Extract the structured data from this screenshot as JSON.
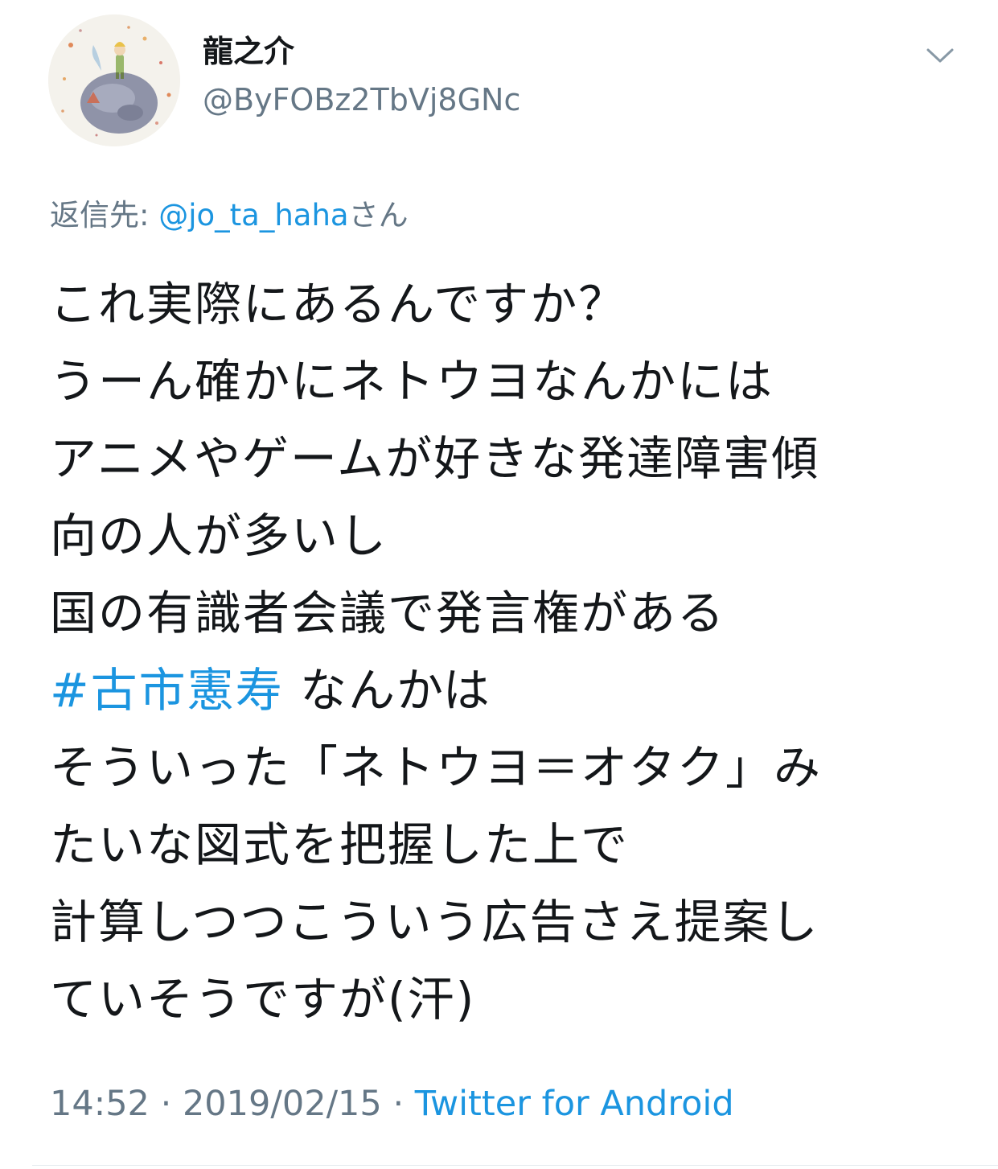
{
  "tweet": {
    "display_name": "龍之介",
    "handle": "@ByFOBz2TbVj8GNc",
    "avatar_icon": "little-prince-planet-avatar",
    "menu_icon": "chevron-down-icon",
    "reply": {
      "prefix": "返信先: ",
      "mention": "@jo_ta_haha",
      "suffix": "さん"
    },
    "lines": [
      "これ実際にあるんですか？",
      "うーん確かにネトウヨなんかには",
      "アニメやゲームが好きな発達障害傾",
      "向の人が多いし",
      "国の有識者会議で発言権がある"
    ],
    "hashtag": "#古市憲寿",
    "hashtag_suffix": " なんかは",
    "lines_after": [
      "そういった「ネトウヨ＝オタク」み",
      "たいな図式を把握した上で",
      "計算しつつこういう広告さえ提案し",
      "ていそうですが(汗)"
    ],
    "time": "14:52",
    "separator": " · ",
    "date": "2019/02/15",
    "source": "Twitter for Android"
  },
  "colors": {
    "link": "#1b95e0",
    "secondary_text": "#657786",
    "primary_text": "#14171a"
  }
}
